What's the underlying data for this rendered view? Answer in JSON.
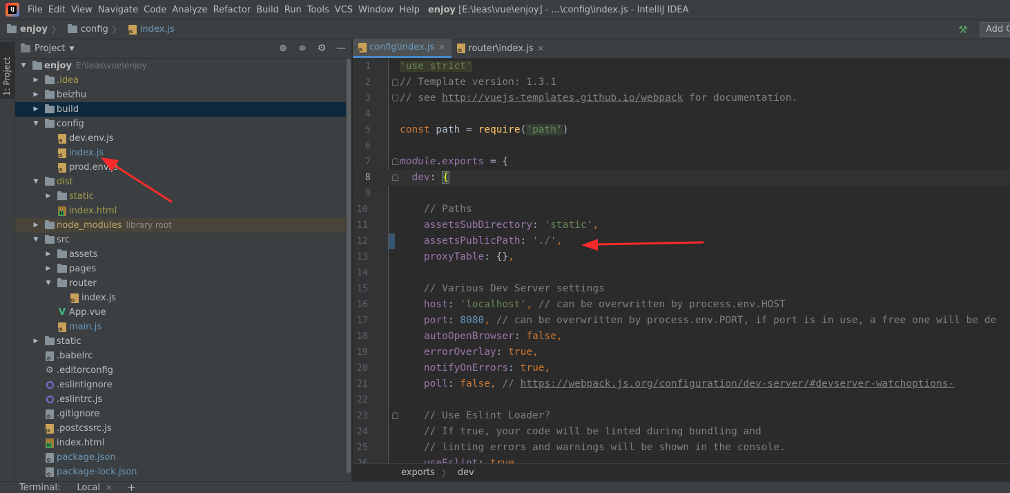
{
  "menubar": {
    "app_icon": "intellij-icon",
    "items": [
      "File",
      "Edit",
      "View",
      "Navigate",
      "Code",
      "Analyze",
      "Refactor",
      "Build",
      "Run",
      "Tools",
      "VCS",
      "Window",
      "Help"
    ],
    "title_project": "enjoy",
    "title_rest": "[E:\\leas\\vue\\enjoy] - ...\\config\\index.js - IntelliJ IDEA"
  },
  "navbar": {
    "crumbs": [
      "enjoy",
      "config",
      "index.js"
    ],
    "add_config_label": "Add Configuration..."
  },
  "toolstrip": {
    "project_tab": "1: Project"
  },
  "project_panel": {
    "title": "Project",
    "tools": [
      "target-icon",
      "collapse-icon",
      "gear-icon",
      "minimize-icon"
    ],
    "tree": [
      {
        "name": "enjoy",
        "hint": "E:\\leas\\vue\\enjoy",
        "depth": 0,
        "type": "root",
        "arrow": "down"
      },
      {
        "name": ".idea",
        "depth": 1,
        "type": "folder",
        "arrow": "right",
        "color": "olive"
      },
      {
        "name": "beizhu",
        "depth": 1,
        "type": "folder",
        "arrow": "right"
      },
      {
        "name": "build",
        "depth": 1,
        "type": "folder",
        "arrow": "right",
        "selected": true
      },
      {
        "name": "config",
        "depth": 1,
        "type": "folder",
        "arrow": "down"
      },
      {
        "name": "dev.env.js",
        "depth": 2,
        "type": "js"
      },
      {
        "name": "index.js",
        "depth": 2,
        "type": "js",
        "color": "blue"
      },
      {
        "name": "prod.env.js",
        "depth": 2,
        "type": "js"
      },
      {
        "name": "dist",
        "depth": 1,
        "type": "folder",
        "arrow": "down",
        "color": "olive"
      },
      {
        "name": "static",
        "depth": 2,
        "type": "folder",
        "arrow": "right",
        "color": "olive"
      },
      {
        "name": "index.html",
        "depth": 2,
        "type": "html",
        "color": "olive"
      },
      {
        "name": "node_modules",
        "hint": "library root",
        "depth": 1,
        "type": "folder",
        "arrow": "right",
        "color": "yellow",
        "excluded": true
      },
      {
        "name": "src",
        "depth": 1,
        "type": "folder",
        "arrow": "down"
      },
      {
        "name": "assets",
        "depth": 2,
        "type": "folder",
        "arrow": "right"
      },
      {
        "name": "pages",
        "depth": 2,
        "type": "folder",
        "arrow": "right"
      },
      {
        "name": "router",
        "depth": 2,
        "type": "folder",
        "arrow": "down"
      },
      {
        "name": "index.js",
        "depth": 3,
        "type": "js"
      },
      {
        "name": "App.vue",
        "depth": 2,
        "type": "vue"
      },
      {
        "name": "main.js",
        "depth": 2,
        "type": "js",
        "color": "blue"
      },
      {
        "name": "static",
        "depth": 1,
        "type": "folder",
        "arrow": "right"
      },
      {
        "name": ".babelrc",
        "depth": 1,
        "type": "cfg"
      },
      {
        "name": ".editorconfig",
        "depth": 1,
        "type": "gear"
      },
      {
        "name": ".eslintignore",
        "depth": 1,
        "type": "ring"
      },
      {
        "name": ".eslintrc.js",
        "depth": 1,
        "type": "ring"
      },
      {
        "name": ".gitignore",
        "depth": 1,
        "type": "cfg"
      },
      {
        "name": ".postcssrc.js",
        "depth": 1,
        "type": "js"
      },
      {
        "name": "index.html",
        "depth": 1,
        "type": "html"
      },
      {
        "name": "package.json",
        "depth": 1,
        "type": "cfg",
        "color": "blue"
      },
      {
        "name": "package-lock.json",
        "depth": 1,
        "type": "cfg",
        "color": "blue"
      }
    ]
  },
  "editor": {
    "tabs": [
      {
        "label": "config\\index.js",
        "active": true
      },
      {
        "label": "router\\index.js",
        "active": false
      }
    ],
    "current_line": 8,
    "breadcrumb": [
      "exports",
      "dev"
    ]
  },
  "terminal": {
    "label": "Terminal:",
    "tab": "Local",
    "add": "+"
  },
  "colors": {
    "background": "#2b2b2b",
    "panel": "#3c3f41",
    "annotation_arrow": "#ff2a2a",
    "accent": "#4a88c7"
  }
}
